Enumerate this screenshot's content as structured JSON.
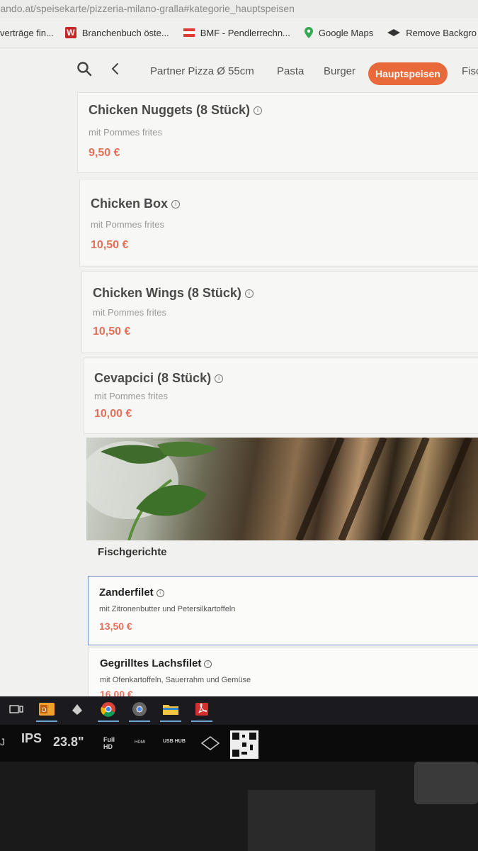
{
  "browser": {
    "url": "lieferando.at/speisekarte/pizzeria-milano-gralla#kategorie_hauptspeisen",
    "bookmarks": [
      {
        "label": "verträge fin...",
        "icon": "none"
      },
      {
        "label": "Branchenbuch öste...",
        "icon": "w-logo-icon"
      },
      {
        "label": "BMF - Pendlerrechn...",
        "icon": "austria-flag-icon"
      },
      {
        "label": "Google Maps",
        "icon": "map-pin-icon"
      },
      {
        "label": "Remove Backgro",
        "icon": "remove-bg-icon"
      }
    ]
  },
  "category_nav": {
    "search_icon": "search-icon",
    "back_icon": "chevron-left-icon",
    "tabs": [
      {
        "label": "Partner Pizza Ø 55cm",
        "active": false
      },
      {
        "label": "Pasta",
        "active": false
      },
      {
        "label": "Burger",
        "active": false
      },
      {
        "label": "Hauptspeisen",
        "active": true
      },
      {
        "label": "Fisc",
        "active": false
      }
    ],
    "active_color": "#e8693a"
  },
  "hauptspeisen": [
    {
      "name": "Chicken Nuggets (8 Stück)",
      "desc": "mit Pommes frites",
      "price": "9,50 €"
    },
    {
      "name": "Chicken Box",
      "desc": "mit Pommes frites",
      "price": "10,50 €"
    },
    {
      "name": "Chicken Wings (8 Stück)",
      "desc": "mit Pommes frites",
      "price": "10,50 €"
    },
    {
      "name": "Cevapcici (8 Stück)",
      "desc": "mit Pommes frites",
      "price": "10,00 €"
    }
  ],
  "fischgerichte": {
    "title": "Fischgerichte",
    "items": [
      {
        "name": "Zanderfilet",
        "desc": "mit Zitronenbutter und Petersilkartoffeln",
        "price": "13,50 €"
      },
      {
        "name": "Gegrilltes Lachsfilet",
        "desc": "mit Ofenkartoffeln, Sauerrahm und Gemüse",
        "price": "16,00 €"
      }
    ]
  },
  "price_color": "#e2705a",
  "taskbar": {
    "icons": [
      "task-view-icon",
      "outlook-icon",
      "app-icon",
      "chrome-icon",
      "chrome-alt-icon",
      "file-explorer-icon",
      "acrobat-icon"
    ]
  },
  "monitor_bezel": {
    "panel": "IPS",
    "size": "23.8\"",
    "hd": "Full HD",
    "ports": "HDMI",
    "usb": "USB HUB"
  }
}
